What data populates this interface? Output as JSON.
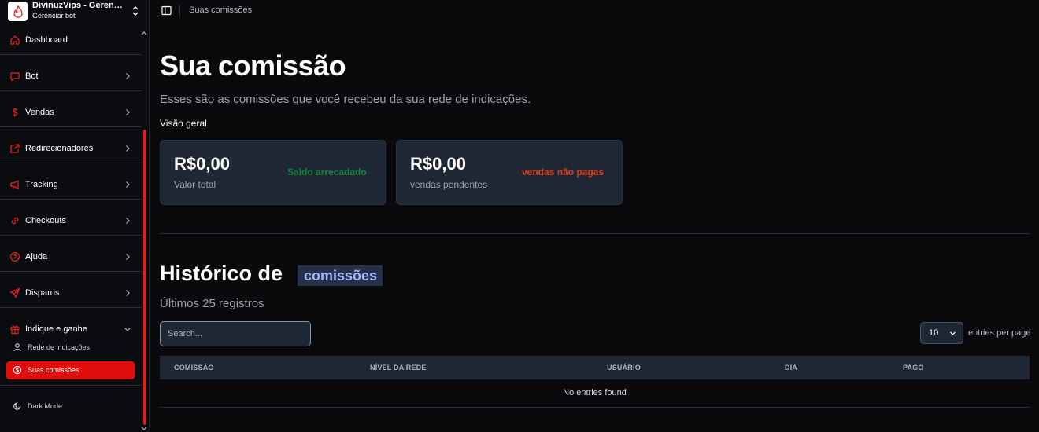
{
  "brand": {
    "title": "DivinuzVips - Gerenciador",
    "subtitle": "Gerenciar bot"
  },
  "sidebar": {
    "items": [
      {
        "label": "Dashboard",
        "icon": "home-icon"
      },
      {
        "label": "Bot",
        "icon": "chat-icon"
      },
      {
        "label": "Vendas",
        "icon": "dollar-icon"
      },
      {
        "label": "Redirecionadores",
        "icon": "external-link-icon"
      },
      {
        "label": "Tracking",
        "icon": "megaphone-icon"
      },
      {
        "label": "Checkouts",
        "icon": "link-icon"
      },
      {
        "label": "Ajuda",
        "icon": "help-icon"
      },
      {
        "label": "Disparos",
        "icon": "send-icon"
      },
      {
        "label": "Indique e ganhe",
        "icon": "gift-icon"
      }
    ],
    "sub_items": [
      {
        "label": "Rede de indicações",
        "icon": "user-icon"
      },
      {
        "label": "Suas comissões",
        "icon": "coin-icon",
        "active": true
      }
    ],
    "dark_mode_label": "Dark Mode"
  },
  "header": {
    "breadcrumb": "Suas comissões"
  },
  "main": {
    "title": "Sua comissão",
    "subtitle": "Esses são as comissões que você recebeu da sua rede de indicações.",
    "overview_label": "Visão geral",
    "cards": [
      {
        "value": "R$0,00",
        "description": "Valor total",
        "tag": "Saldo arrecadado",
        "tag_color": "#15803d"
      },
      {
        "value": "R$0,00",
        "description": "vendas pendentes",
        "tag": "vendas não pagas",
        "tag_color": "#dc3a12"
      }
    ],
    "history": {
      "title": "Histórico de",
      "highlight": "comissões",
      "subtitle": "Últimos 25 registros"
    },
    "table": {
      "search_placeholder": "Search...",
      "per_page_value": "10",
      "per_page_label": "entries per page",
      "columns": [
        "COMISSÃO",
        "NÍVEL DA REDE",
        "USUÁRIO",
        "DIA",
        "PAGO"
      ],
      "empty_text": "No entries found"
    }
  },
  "colors": {
    "accent": "#e00d0d",
    "card_bg": "#1f2735",
    "background": "#0a0a0c"
  }
}
